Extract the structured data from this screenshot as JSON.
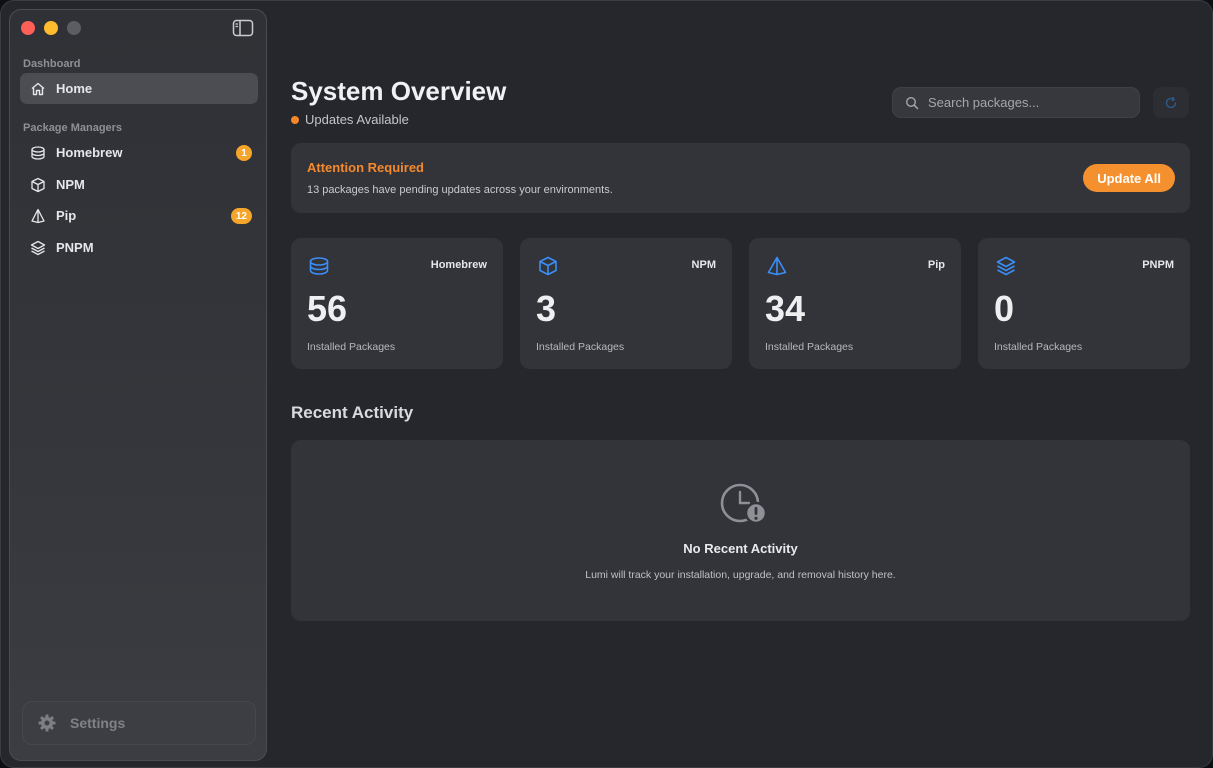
{
  "sidebar": {
    "dashboard_label": "Dashboard",
    "home_label": "Home",
    "package_managers_label": "Package Managers",
    "items": [
      {
        "label": "Homebrew",
        "badge": "1"
      },
      {
        "label": "NPM",
        "badge": null
      },
      {
        "label": "Pip",
        "badge": "12"
      },
      {
        "label": "PNPM",
        "badge": null
      }
    ],
    "settings_label": "Settings"
  },
  "header": {
    "title": "System Overview",
    "status": "Updates Available",
    "search_placeholder": "Search packages..."
  },
  "attention": {
    "title": "Attention Required",
    "message": "13 packages have pending updates across your environments.",
    "button": "Update All"
  },
  "stats": [
    {
      "name": "Homebrew",
      "count": "56",
      "label": "Installed Packages"
    },
    {
      "name": "NPM",
      "count": "3",
      "label": "Installed Packages"
    },
    {
      "name": "Pip",
      "count": "34",
      "label": "Installed Packages"
    },
    {
      "name": "PNPM",
      "count": "0",
      "label": "Installed Packages"
    }
  ],
  "recent": {
    "title": "Recent Activity",
    "empty_title": "No Recent Activity",
    "empty_message": "Lumi will track your installation, upgrade, and removal history here."
  },
  "colors": {
    "accent_orange": "#f5902e",
    "icon_blue": "#3a8ef6",
    "badge": "#f5a52a"
  }
}
